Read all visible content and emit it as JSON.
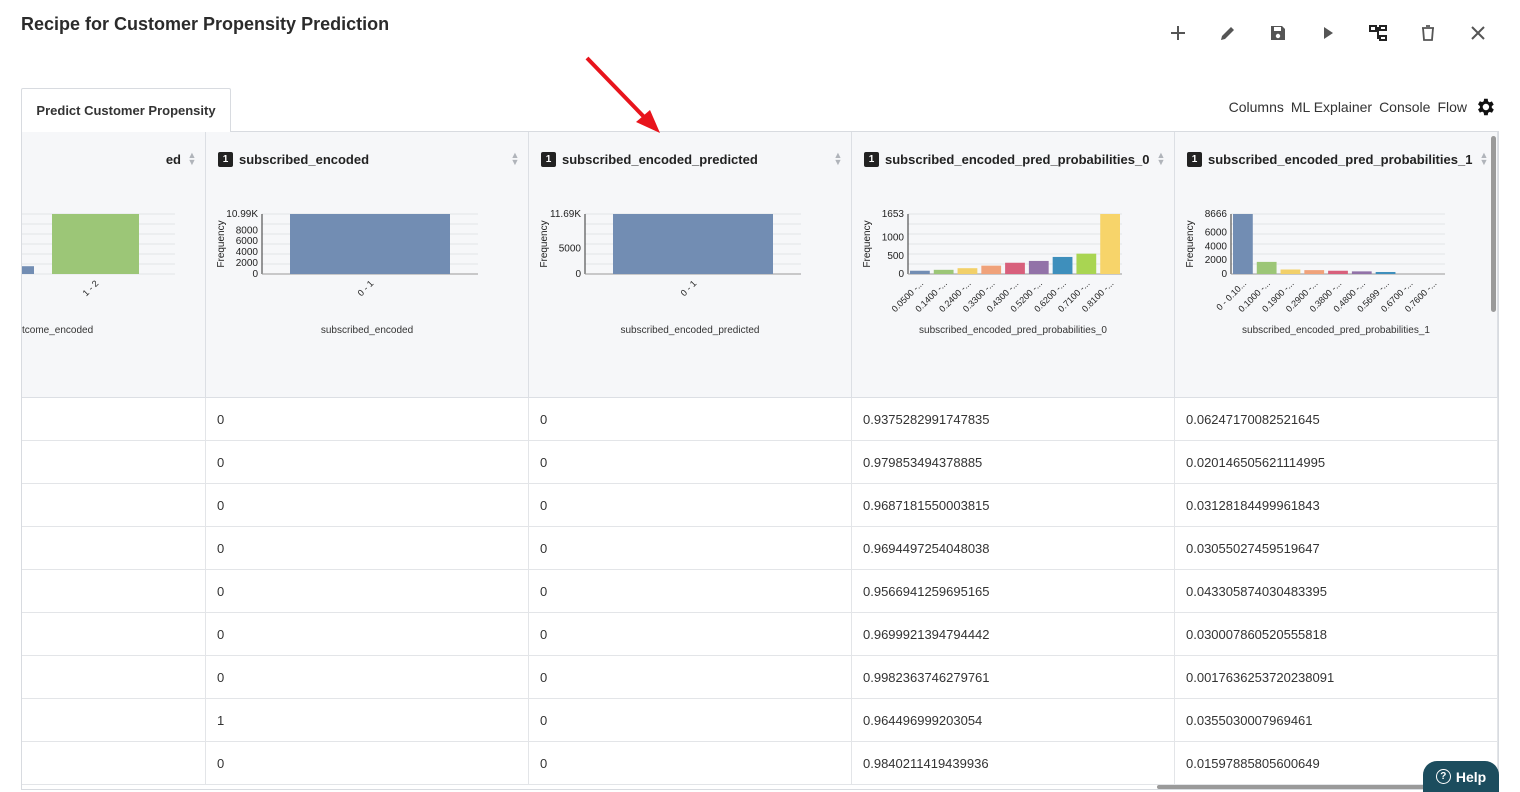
{
  "page": {
    "title": "Recipe for Customer Propensity Prediction"
  },
  "toolbar": [
    {
      "name": "add-icon"
    },
    {
      "name": "edit-icon"
    },
    {
      "name": "save-icon"
    },
    {
      "name": "run-icon"
    },
    {
      "name": "flow-tree-icon"
    },
    {
      "name": "delete-icon"
    },
    {
      "name": "close-icon"
    }
  ],
  "tabs": [
    {
      "label": "Predict Customer Propensity"
    }
  ],
  "links": {
    "columns": "Columns",
    "ml_explainer": "ML Explainer",
    "console": "Console",
    "flow": "Flow"
  },
  "colors": {
    "bar_blue": "#728db3",
    "bar_green": "#9cc677",
    "help_bg": "#1c4d5e",
    "arrow": "#e8141c"
  },
  "columns": [
    {
      "title": "ed",
      "badge": "",
      "xname": "tcome_encoded",
      "chart_data": {
        "type": "bar",
        "ylabel": "",
        "categories": [
          "",
          "1 - 2"
        ],
        "values": [
          0.13,
          1
        ],
        "colors": [
          "#728db3",
          "#9cc677"
        ],
        "ticks": []
      }
    },
    {
      "title": "subscribed_encoded",
      "badge": "1",
      "xname": "subscribed_encoded",
      "chart_data": {
        "type": "bar",
        "ylabel": "Frequency",
        "categories": [
          "0 - 1"
        ],
        "values": [
          10990
        ],
        "colors": [
          "#728db3"
        ],
        "ticks": [
          "10.99K",
          "8000",
          "6000",
          "4000",
          "2000",
          "0"
        ],
        "tick_values": [
          10990,
          8000,
          6000,
          4000,
          2000,
          0
        ],
        "ymax": 10990
      }
    },
    {
      "title": "subscribed_encoded_predicted",
      "badge": "1",
      "xname": "subscribed_encoded_predicted",
      "chart_data": {
        "type": "bar",
        "ylabel": "Frequency",
        "categories": [
          "0 - 1"
        ],
        "values": [
          11690
        ],
        "colors": [
          "#728db3"
        ],
        "ticks": [
          "11.69K",
          "5000",
          "0"
        ],
        "tick_values": [
          11690,
          5000,
          0
        ],
        "ymax": 11690
      }
    },
    {
      "title": "subscribed_encoded_pred_probabilities_0",
      "badge": "1",
      "xname": "subscribed_encoded_pred_probabilities_0",
      "chart_data": {
        "type": "bar",
        "ylabel": "Frequency",
        "categories": [
          "0.0500 -...",
          "0.1400 -...",
          "0.2400 -...",
          "0.3300 -...",
          "0.4300 -...",
          "0.5200 -...",
          "0.6200 -...",
          "0.7100 -...",
          "0.8100 -..."
        ],
        "values": [
          90,
          115,
          160,
          230,
          310,
          360,
          470,
          560,
          1653
        ],
        "colors": [
          "#728db3",
          "#9cc677",
          "#f2d069",
          "#f0a27a",
          "#d8607c",
          "#9272a8",
          "#3e8fbc",
          "#a9d552",
          "#f7d46a"
        ],
        "ticks": [
          "1653",
          "1000",
          "500",
          "0"
        ],
        "tick_values": [
          1653,
          1000,
          500,
          0
        ],
        "ymax": 1653
      }
    },
    {
      "title": "subscribed_encoded_pred_probabilities_1",
      "badge": "1",
      "xname": "subscribed_encoded_pred_probabilities_1",
      "chart_data": {
        "type": "bar",
        "ylabel": "Frequency",
        "categories": [
          "0 - 0.10...",
          "0.1000 -...",
          "0.1900 -...",
          "0.2900 -...",
          "0.3800 -...",
          "0.4800 -...",
          "0.5699 -...",
          "0.6700 -...",
          "0.7600 -..."
        ],
        "values": [
          8666,
          1750,
          650,
          560,
          470,
          380,
          290,
          0,
          0
        ],
        "colors": [
          "#728db3",
          "#9cc677",
          "#f2d069",
          "#f0a27a",
          "#d8607c",
          "#9272a8",
          "#3e8fbc",
          "#a9d552",
          "#f7d46a"
        ],
        "ticks": [
          "8666",
          "6000",
          "4000",
          "2000",
          "0"
        ],
        "tick_values": [
          8666,
          6000,
          4000,
          2000,
          0
        ],
        "ymax": 8666
      }
    }
  ],
  "rows": [
    [
      "",
      "0",
      "0",
      "0.9375282991747835",
      "0.06247170082521645"
    ],
    [
      "",
      "0",
      "0",
      "0.979853494378885",
      "0.020146505621114995"
    ],
    [
      "",
      "0",
      "0",
      "0.9687181550003815",
      "0.03128184499961843"
    ],
    [
      "",
      "0",
      "0",
      "0.9694497254048038",
      "0.03055027459519647"
    ],
    [
      "",
      "0",
      "0",
      "0.9566941259695165",
      "0.043305874030483395"
    ],
    [
      "",
      "0",
      "0",
      "0.9699921394794442",
      "0.030007860520555818"
    ],
    [
      "",
      "0",
      "0",
      "0.9982363746279761",
      "0.0017636253720238091"
    ],
    [
      "",
      "1",
      "0",
      "0.964496999203054",
      "0.0355030007969461"
    ],
    [
      "",
      "0",
      "0",
      "0.9840211419439936",
      "0.01597885805600649"
    ]
  ],
  "help": {
    "label": "Help",
    "q": "?"
  }
}
